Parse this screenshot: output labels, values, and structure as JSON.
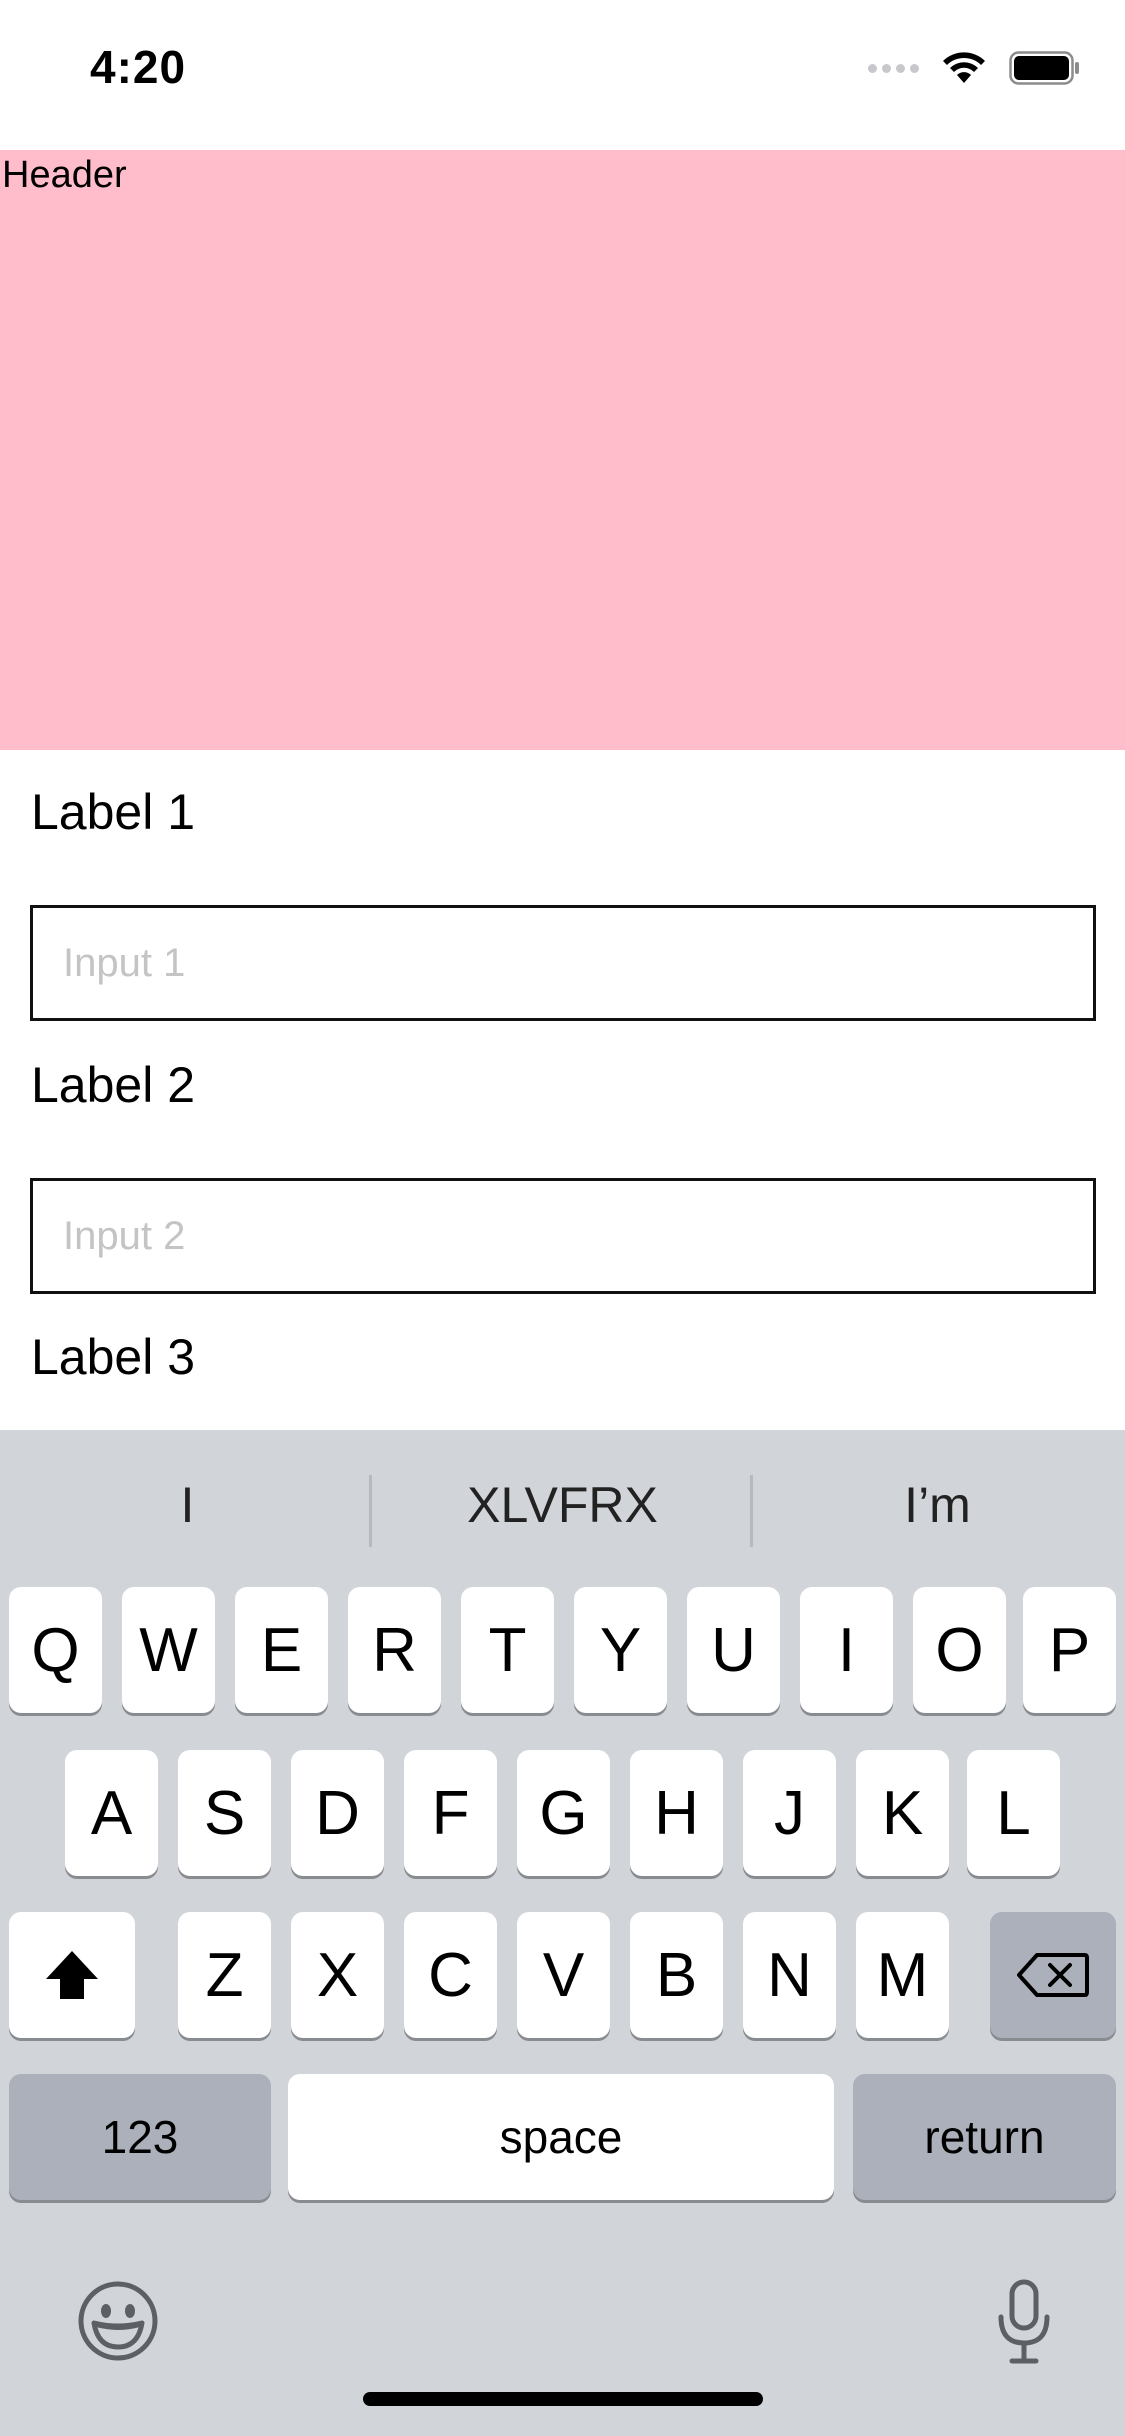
{
  "status_bar": {
    "time": "4:20"
  },
  "header": {
    "text": "Header",
    "background": "#ffbccb"
  },
  "form": {
    "label1": "Label 1",
    "input1_placeholder": "Input 1",
    "label2": "Label 2",
    "input2_placeholder": "Input 2",
    "label3": "Label 3"
  },
  "keyboard": {
    "suggestions": [
      "I",
      "XLVFRX",
      "I’m"
    ],
    "row1": [
      "Q",
      "W",
      "E",
      "R",
      "T",
      "Y",
      "U",
      "I",
      "O",
      "P"
    ],
    "row2": [
      "A",
      "S",
      "D",
      "F",
      "G",
      "H",
      "J",
      "K",
      "L"
    ],
    "row3": [
      "Z",
      "X",
      "C",
      "V",
      "B",
      "N",
      "M"
    ],
    "numbers_label": "123",
    "space_label": "space",
    "return_label": "return"
  }
}
